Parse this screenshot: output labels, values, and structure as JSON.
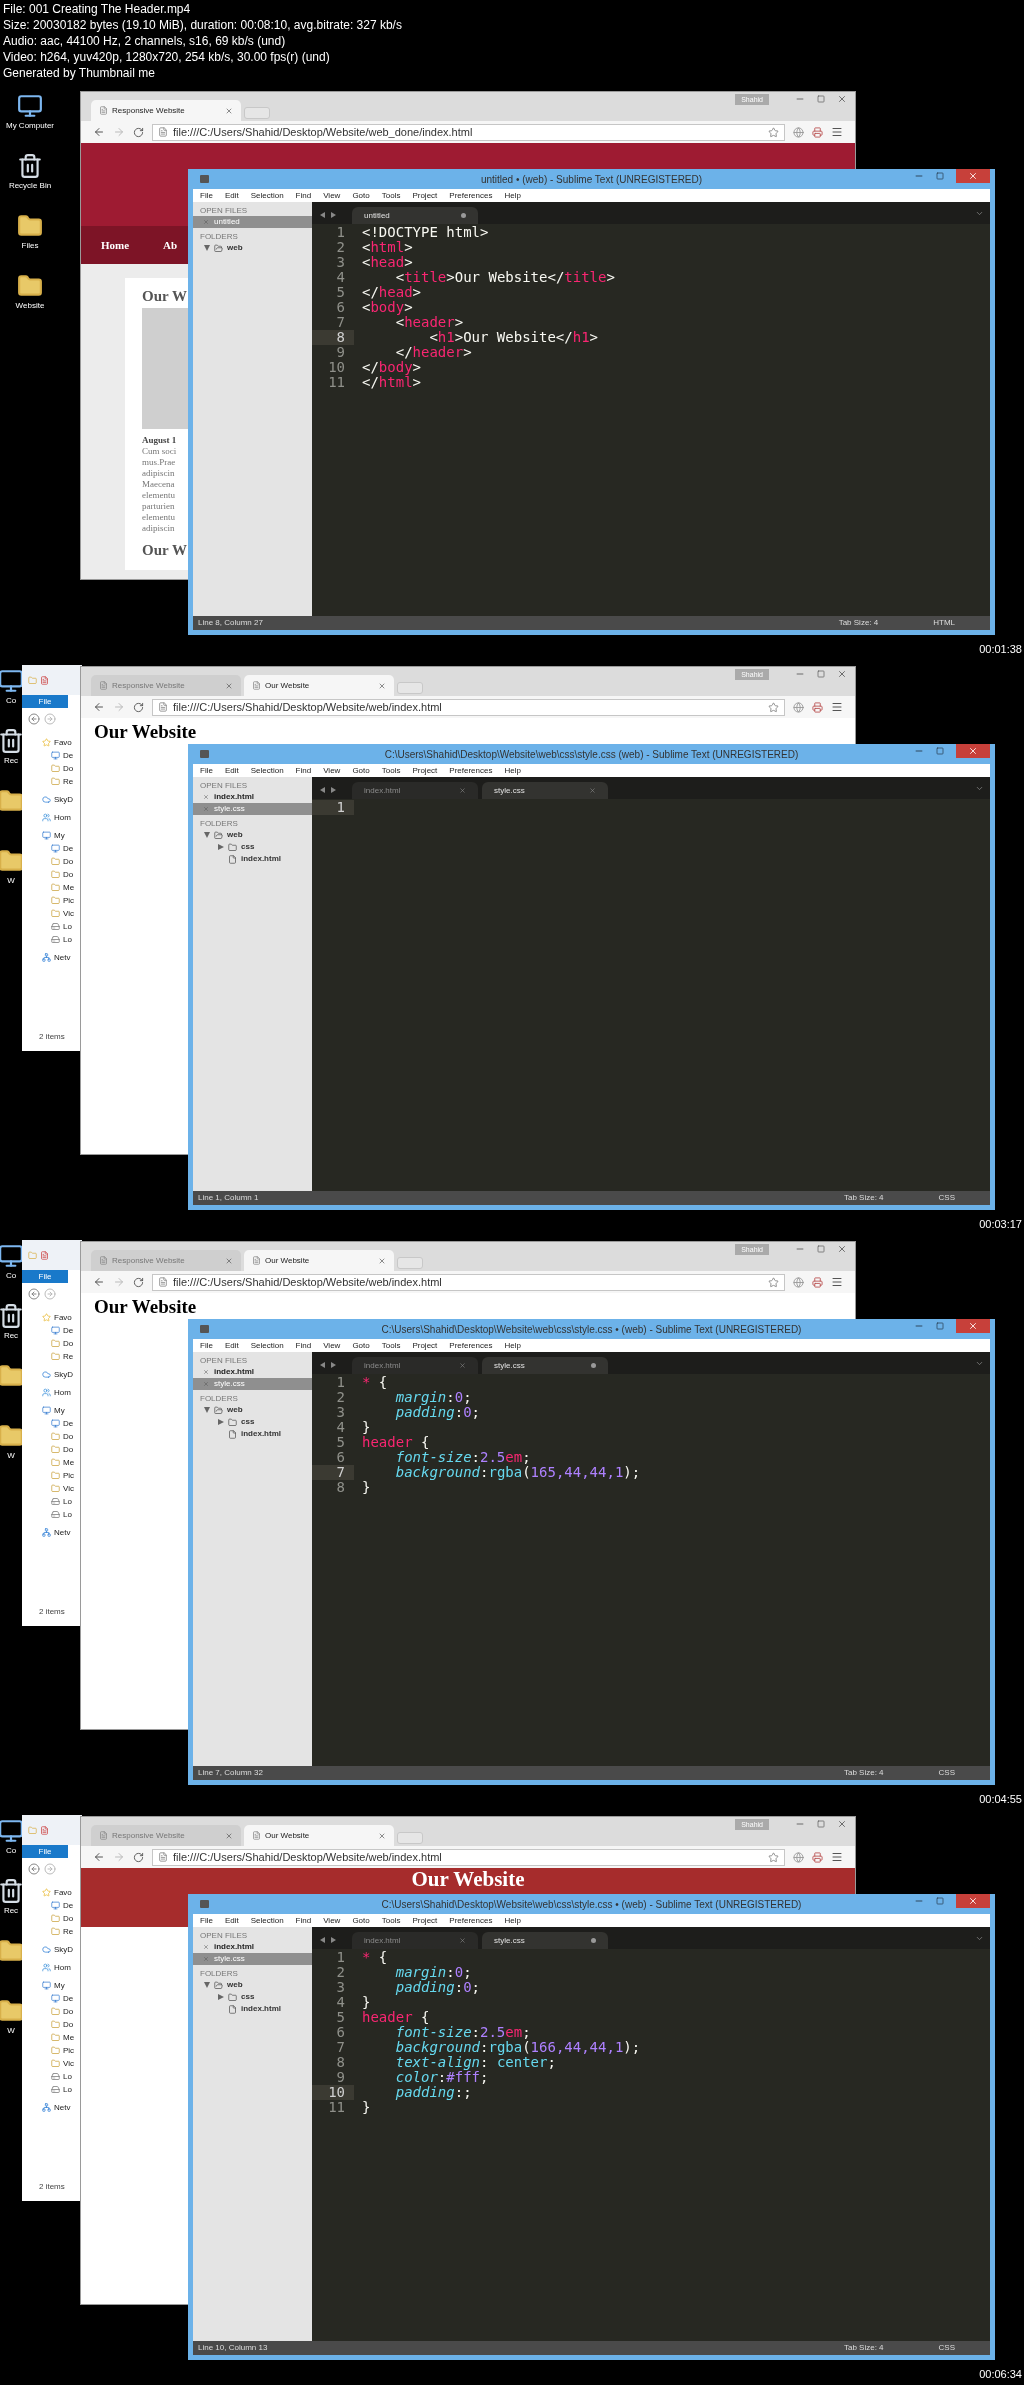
{
  "info": [
    "File: 001 Creating The Header.mp4",
    "Size: 20030182 bytes (19.10 MiB), duration: 00:08:10, avg.bitrate: 327 kb/s",
    "Audio: aac, 44100 Hz, 2 channels, s16, 69 kb/s (und)",
    "Video: h264, yuv420p, 1280x720, 254 kb/s, 30.00 fps(r) (und)",
    "Generated by Thumbnail me"
  ],
  "frames": [
    {
      "desktop_icons": [
        {
          "kind": "computer",
          "label": "My Computer"
        },
        {
          "kind": "recycle_bin",
          "label": "Recycle Bin"
        },
        {
          "kind": "folder",
          "label": "Files"
        },
        {
          "kind": "folder",
          "label": "Website"
        }
      ],
      "browser": {
        "user": "Shahid",
        "tabs": [
          {
            "label": "Responsive Website",
            "selected": true
          }
        ],
        "url": "file:///C:/Users/Shahid/Desktop/Website/web_done/index.html",
        "page": {
          "kind": "site",
          "nav": [
            "Home",
            "Ab"
          ],
          "article": {
            "title": "Our W",
            "date": "August 1",
            "lines": [
              "Cum soci",
              "mus.Prae",
              "adipiscin",
              "Maecena",
              "elementu",
              "parturien",
              "elementu",
              "adipiscin"
            ],
            "next_title": "Our W"
          }
        }
      },
      "editor": {
        "title": "untitled • (web) - Sublime Text (UNREGISTERED)",
        "menu": [
          "File",
          "Edit",
          "Selection",
          "Find",
          "View",
          "Goto",
          "Tools",
          "Project",
          "Preferences",
          "Help"
        ],
        "open_files_label": "OPEN FILES",
        "open_files": [
          {
            "name": "untitled",
            "selected": true
          }
        ],
        "folders_label": "FOLDERS",
        "folders": [
          {
            "name": "web",
            "kind": "folder",
            "expanded": true
          }
        ],
        "tabs": [
          {
            "label": "untitled",
            "selected": true,
            "modified": true
          }
        ],
        "lines": [
          {
            "number": "1",
            "current": false,
            "tokens": [
              {
                "kind": "plain",
                "text": "<!DOCTYPE html>"
              }
            ]
          },
          {
            "number": "2",
            "current": false,
            "tokens": [
              {
                "kind": "plain",
                "text": "<"
              },
              {
                "kind": "tag",
                "text": "html"
              },
              {
                "kind": "plain",
                "text": ">"
              }
            ]
          },
          {
            "number": "3",
            "current": false,
            "tokens": [
              {
                "kind": "plain",
                "text": "<"
              },
              {
                "kind": "tag",
                "text": "head"
              },
              {
                "kind": "plain",
                "text": ">"
              }
            ]
          },
          {
            "number": "4",
            "current": false,
            "tokens": [
              {
                "kind": "plain",
                "text": "    <"
              },
              {
                "kind": "tag",
                "text": "title"
              },
              {
                "kind": "plain",
                "text": ">Our Website</"
              },
              {
                "kind": "tag",
                "text": "title"
              },
              {
                "kind": "plain",
                "text": ">"
              }
            ]
          },
          {
            "number": "5",
            "current": false,
            "tokens": [
              {
                "kind": "plain",
                "text": "</"
              },
              {
                "kind": "tag",
                "text": "head"
              },
              {
                "kind": "plain",
                "text": ">"
              }
            ]
          },
          {
            "number": "6",
            "current": false,
            "tokens": [
              {
                "kind": "plain",
                "text": "<"
              },
              {
                "kind": "tag",
                "text": "body"
              },
              {
                "kind": "plain",
                "text": ">"
              }
            ]
          },
          {
            "number": "7",
            "current": false,
            "tokens": [
              {
                "kind": "plain",
                "text": "    <"
              },
              {
                "kind": "tag",
                "text": "header"
              },
              {
                "kind": "plain",
                "text": ">"
              }
            ]
          },
          {
            "number": "8",
            "current": true,
            "tokens": [
              {
                "kind": "plain",
                "text": "        <"
              },
              {
                "kind": "tag",
                "text": "h1"
              },
              {
                "kind": "plain",
                "text": ">Our Website</"
              },
              {
                "kind": "tag",
                "text": "h1"
              },
              {
                "kind": "plain",
                "text": ">"
              }
            ]
          },
          {
            "number": "9",
            "current": false,
            "tokens": [
              {
                "kind": "plain",
                "text": "    </"
              },
              {
                "kind": "tag",
                "text": "header"
              },
              {
                "kind": "plain",
                "text": ">"
              }
            ]
          },
          {
            "number": "10",
            "current": false,
            "tokens": [
              {
                "kind": "plain",
                "text": "</"
              },
              {
                "kind": "tag",
                "text": "body"
              },
              {
                "kind": "plain",
                "text": ">"
              }
            ]
          },
          {
            "number": "11",
            "current": false,
            "tokens": [
              {
                "kind": "plain",
                "text": "</"
              },
              {
                "kind": "tag",
                "text": "html"
              },
              {
                "kind": "plain",
                "text": ">"
              }
            ]
          }
        ],
        "status": "Line 8, Column 27",
        "tab_size": "Tab Size: 4",
        "syntax": "HTML"
      },
      "timestamp": "00:01:38"
    },
    {
      "desktop_icons": [
        {
          "kind": "computer",
          "label": "Co"
        },
        {
          "kind": "recycle_bin",
          "label": "Rec"
        },
        {
          "kind": "folder"
        },
        {
          "kind": "folder",
          "label": "W"
        }
      ],
      "explorer": {
        "button": "File",
        "nav": [
          {
            "label": "Favo",
            "kind": "star",
            "children": [
              {
                "label": "De",
                "kind": "desktop"
              },
              {
                "label": "Do",
                "kind": "folder"
              },
              {
                "label": "Re",
                "kind": "folder"
              }
            ]
          },
          {
            "label": "SkyD",
            "kind": "cloud"
          },
          {
            "label": "Hom",
            "kind": "group"
          },
          {
            "label": "My",
            "kind": "computer",
            "children": [
              {
                "label": "De",
                "kind": "desktop"
              },
              {
                "label": "Do",
                "kind": "folder"
              },
              {
                "label": "Do",
                "kind": "folder"
              },
              {
                "label": "Me",
                "kind": "folder"
              },
              {
                "label": "Pic",
                "kind": "folder"
              },
              {
                "label": "Vic",
                "kind": "folder"
              },
              {
                "label": "Lo",
                "kind": "drive"
              },
              {
                "label": "Lo",
                "kind": "drive"
              }
            ]
          },
          {
            "label": "Netv",
            "kind": "network"
          }
        ],
        "status": "2 items"
      },
      "browser": {
        "user": "Shahid",
        "tabs": [
          {
            "label": "Responsive Website",
            "selected": false
          },
          {
            "label": "Our Website",
            "selected": true
          }
        ],
        "url": "file:///C:/Users/Shahid/Desktop/Website/web/index.html",
        "page": {
          "kind": "heading",
          "heading": "Our Website"
        }
      },
      "editor": {
        "title": "C:\\Users\\Shahid\\Desktop\\Website\\web\\css\\style.css (web) - Sublime Text (UNREGISTERED)",
        "menu": [
          "File",
          "Edit",
          "Selection",
          "Find",
          "View",
          "Goto",
          "Tools",
          "Project",
          "Preferences",
          "Help"
        ],
        "open_files_label": "OPEN FILES",
        "open_files": [
          {
            "name": "index.html",
            "selected": false
          },
          {
            "name": "style.css",
            "selected": true
          }
        ],
        "folders_label": "FOLDERS",
        "folders": [
          {
            "name": "web",
            "kind": "folder",
            "expanded": true,
            "children": [
              {
                "name": "css",
                "kind": "folder",
                "expanded": false
              },
              {
                "name": "index.html",
                "kind": "file"
              }
            ]
          }
        ],
        "tabs": [
          {
            "label": "index.html",
            "selected": false,
            "modified": false
          },
          {
            "label": "style.css",
            "selected": true,
            "modified": false
          }
        ],
        "lines": [
          {
            "number": "1",
            "current": true
          }
        ],
        "status": "Line 1, Column 1",
        "tab_size": "Tab Size: 4",
        "syntax": "CSS"
      },
      "timestamp": "00:03:17"
    },
    {
      "desktop_icons": [
        {
          "kind": "computer",
          "label": "Co"
        },
        {
          "kind": "recycle_bin",
          "label": "Rec"
        },
        {
          "kind": "folder"
        },
        {
          "kind": "folder",
          "label": "W"
        }
      ],
      "explorer": {
        "button": "File",
        "nav": [
          {
            "label": "Favo",
            "kind": "star",
            "children": [
              {
                "label": "De",
                "kind": "desktop"
              },
              {
                "label": "Do",
                "kind": "folder"
              },
              {
                "label": "Re",
                "kind": "folder"
              }
            ]
          },
          {
            "label": "SkyD",
            "kind": "cloud"
          },
          {
            "label": "Hom",
            "kind": "group"
          },
          {
            "label": "My",
            "kind": "computer",
            "children": [
              {
                "label": "De",
                "kind": "desktop"
              },
              {
                "label": "Do",
                "kind": "folder"
              },
              {
                "label": "Do",
                "kind": "folder"
              },
              {
                "label": "Me",
                "kind": "folder"
              },
              {
                "label": "Pic",
                "kind": "folder"
              },
              {
                "label": "Vic",
                "kind": "folder"
              },
              {
                "label": "Lo",
                "kind": "drive"
              },
              {
                "label": "Lo",
                "kind": "drive"
              }
            ]
          },
          {
            "label": "Netv",
            "kind": "network"
          }
        ],
        "status": "2 items"
      },
      "browser": {
        "user": "Shahid",
        "tabs": [
          {
            "label": "Responsive Website",
            "selected": false
          },
          {
            "label": "Our Website",
            "selected": true
          }
        ],
        "url": "file:///C:/Users/Shahid/Desktop/Website/web/index.html",
        "page": {
          "kind": "heading",
          "heading": "Our Website"
        }
      },
      "editor": {
        "title": "C:\\Users\\Shahid\\Desktop\\Website\\web\\css\\style.css • (web) - Sublime Text (UNREGISTERED)",
        "menu": [
          "File",
          "Edit",
          "Selection",
          "Find",
          "View",
          "Goto",
          "Tools",
          "Project",
          "Preferences",
          "Help"
        ],
        "open_files_label": "OPEN FILES",
        "open_files": [
          {
            "name": "index.html",
            "selected": false
          },
          {
            "name": "style.css",
            "selected": true
          }
        ],
        "folders_label": "FOLDERS",
        "folders": [
          {
            "name": "web",
            "kind": "folder",
            "expanded": true,
            "children": [
              {
                "name": "css",
                "kind": "folder",
                "expanded": false
              },
              {
                "name": "index.html",
                "kind": "file"
              }
            ]
          }
        ],
        "tabs": [
          {
            "label": "index.html",
            "selected": false,
            "modified": false
          },
          {
            "label": "style.css",
            "selected": true,
            "modified": true
          }
        ],
        "lines": [
          {
            "number": "1",
            "current": false,
            "tokens": [
              {
                "kind": "tag",
                "text": "*"
              },
              {
                "kind": "plain",
                "text": " {"
              }
            ]
          },
          {
            "number": "2",
            "current": false,
            "tokens": [
              {
                "kind": "property",
                "text": "    margin"
              },
              {
                "kind": "plain",
                "text": ":"
              },
              {
                "kind": "number",
                "text": "0"
              },
              {
                "kind": "plain",
                "text": ";"
              }
            ]
          },
          {
            "number": "3",
            "current": false,
            "tokens": [
              {
                "kind": "property",
                "text": "    padding"
              },
              {
                "kind": "plain",
                "text": ":"
              },
              {
                "kind": "number",
                "text": "0"
              },
              {
                "kind": "plain",
                "text": ";"
              }
            ]
          },
          {
            "number": "4",
            "current": false,
            "tokens": [
              {
                "kind": "plain",
                "text": "}"
              }
            ]
          },
          {
            "number": "5",
            "current": false,
            "tokens": [
              {
                "kind": "tag",
                "text": "header"
              },
              {
                "kind": "plain",
                "text": " {"
              }
            ]
          },
          {
            "number": "6",
            "current": false,
            "tokens": [
              {
                "kind": "property",
                "text": "    font-size"
              },
              {
                "kind": "plain",
                "text": ":"
              },
              {
                "kind": "number",
                "text": "2.5"
              },
              {
                "kind": "tag",
                "text": "em"
              },
              {
                "kind": "plain",
                "text": ";"
              }
            ]
          },
          {
            "number": "7",
            "current": true,
            "tokens": [
              {
                "kind": "property",
                "text": "    background"
              },
              {
                "kind": "plain",
                "text": ":"
              },
              {
                "kind": "function",
                "text": "rgba"
              },
              {
                "kind": "plain",
                "text": "("
              },
              {
                "kind": "number",
                "text": "165,44,44,1"
              },
              {
                "kind": "plain",
                "text": ");"
              }
            ]
          },
          {
            "number": "8",
            "current": false,
            "tokens": [
              {
                "kind": "plain",
                "text": "}"
              }
            ]
          }
        ],
        "status": "Line 7, Column 32",
        "tab_size": "Tab Size: 4",
        "syntax": "CSS"
      },
      "timestamp": "00:04:55"
    },
    {
      "desktop_icons": [
        {
          "kind": "computer",
          "label": "Co"
        },
        {
          "kind": "recycle_bin",
          "label": "Rec"
        },
        {
          "kind": "folder"
        },
        {
          "kind": "folder",
          "label": "W"
        }
      ],
      "explorer": {
        "button": "File",
        "nav": [
          {
            "label": "Favo",
            "kind": "star",
            "children": [
              {
                "label": "De",
                "kind": "desktop"
              },
              {
                "label": "Do",
                "kind": "folder"
              },
              {
                "label": "Re",
                "kind": "folder"
              }
            ]
          },
          {
            "label": "SkyD",
            "kind": "cloud"
          },
          {
            "label": "Hom",
            "kind": "group"
          },
          {
            "label": "My",
            "kind": "computer",
            "children": [
              {
                "label": "De",
                "kind": "desktop"
              },
              {
                "label": "Do",
                "kind": "folder"
              },
              {
                "label": "Do",
                "kind": "folder"
              },
              {
                "label": "Me",
                "kind": "folder"
              },
              {
                "label": "Pic",
                "kind": "folder"
              },
              {
                "label": "Vic",
                "kind": "folder"
              },
              {
                "label": "Lo",
                "kind": "drive"
              },
              {
                "label": "Lo",
                "kind": "drive"
              }
            ]
          },
          {
            "label": "Netv",
            "kind": "network"
          }
        ],
        "status": "2 items"
      },
      "browser": {
        "user": "Shahid",
        "tabs": [
          {
            "label": "Responsive Website",
            "selected": false
          },
          {
            "label": "Our Website",
            "selected": true
          }
        ],
        "url": "file:///C:/Users/Shahid/Desktop/Website/web/index.html",
        "page": {
          "kind": "banner",
          "heading": "Our Website"
        }
      },
      "editor": {
        "title": "C:\\Users\\Shahid\\Desktop\\Website\\web\\css\\style.css • (web) - Sublime Text (UNREGISTERED)",
        "menu": [
          "File",
          "Edit",
          "Selection",
          "Find",
          "View",
          "Goto",
          "Tools",
          "Project",
          "Preferences",
          "Help"
        ],
        "open_files_label": "OPEN FILES",
        "open_files": [
          {
            "name": "index.html",
            "selected": false
          },
          {
            "name": "style.css",
            "selected": true
          }
        ],
        "folders_label": "FOLDERS",
        "folders": [
          {
            "name": "web",
            "kind": "folder",
            "expanded": true,
            "children": [
              {
                "name": "css",
                "kind": "folder",
                "expanded": false
              },
              {
                "name": "index.html",
                "kind": "file"
              }
            ]
          }
        ],
        "tabs": [
          {
            "label": "index.html",
            "selected": false,
            "modified": false
          },
          {
            "label": "style.css",
            "selected": true,
            "modified": true
          }
        ],
        "lines": [
          {
            "number": "1",
            "current": false,
            "tokens": [
              {
                "kind": "tag",
                "text": "*"
              },
              {
                "kind": "plain",
                "text": " {"
              }
            ]
          },
          {
            "number": "2",
            "current": false,
            "tokens": [
              {
                "kind": "property",
                "text": "    margin"
              },
              {
                "kind": "plain",
                "text": ":"
              },
              {
                "kind": "number",
                "text": "0"
              },
              {
                "kind": "plain",
                "text": ";"
              }
            ]
          },
          {
            "number": "3",
            "current": false,
            "tokens": [
              {
                "kind": "property",
                "text": "    padding"
              },
              {
                "kind": "plain",
                "text": ":"
              },
              {
                "kind": "number",
                "text": "0"
              },
              {
                "kind": "plain",
                "text": ";"
              }
            ]
          },
          {
            "number": "4",
            "current": false,
            "tokens": [
              {
                "kind": "plain",
                "text": "}"
              }
            ]
          },
          {
            "number": "5",
            "current": false,
            "tokens": [
              {
                "kind": "tag",
                "text": "header"
              },
              {
                "kind": "plain",
                "text": " {"
              }
            ]
          },
          {
            "number": "6",
            "current": false,
            "tokens": [
              {
                "kind": "property",
                "text": "    font-size"
              },
              {
                "kind": "plain",
                "text": ":"
              },
              {
                "kind": "number",
                "text": "2.5"
              },
              {
                "kind": "tag",
                "text": "em"
              },
              {
                "kind": "plain",
                "text": ";"
              }
            ]
          },
          {
            "number": "7",
            "current": false,
            "tokens": [
              {
                "kind": "property",
                "text": "    background"
              },
              {
                "kind": "plain",
                "text": ":"
              },
              {
                "kind": "function",
                "text": "rgba"
              },
              {
                "kind": "plain",
                "text": "("
              },
              {
                "kind": "number",
                "text": "166,44,44,1"
              },
              {
                "kind": "plain",
                "text": ");"
              }
            ]
          },
          {
            "number": "8",
            "current": false,
            "tokens": [
              {
                "kind": "property",
                "text": "    text-align"
              },
              {
                "kind": "plain",
                "text": ": "
              },
              {
                "kind": "function",
                "text": "center"
              },
              {
                "kind": "plain",
                "text": ";"
              }
            ]
          },
          {
            "number": "9",
            "current": false,
            "tokens": [
              {
                "kind": "property",
                "text": "    color"
              },
              {
                "kind": "plain",
                "text": ":"
              },
              {
                "kind": "number",
                "text": "#fff"
              },
              {
                "kind": "plain",
                "text": ";"
              }
            ]
          },
          {
            "number": "10",
            "current": true,
            "tokens": [
              {
                "kind": "property",
                "text": "    padding"
              },
              {
                "kind": "plain",
                "text": ":;"
              }
            ]
          },
          {
            "number": "11",
            "current": false,
            "tokens": [
              {
                "kind": "plain",
                "text": "}"
              }
            ]
          }
        ],
        "status": "Line 10, Column 13",
        "tab_size": "Tab Size: 4",
        "syntax": "CSS"
      },
      "timestamp": "00:06:34"
    }
  ]
}
